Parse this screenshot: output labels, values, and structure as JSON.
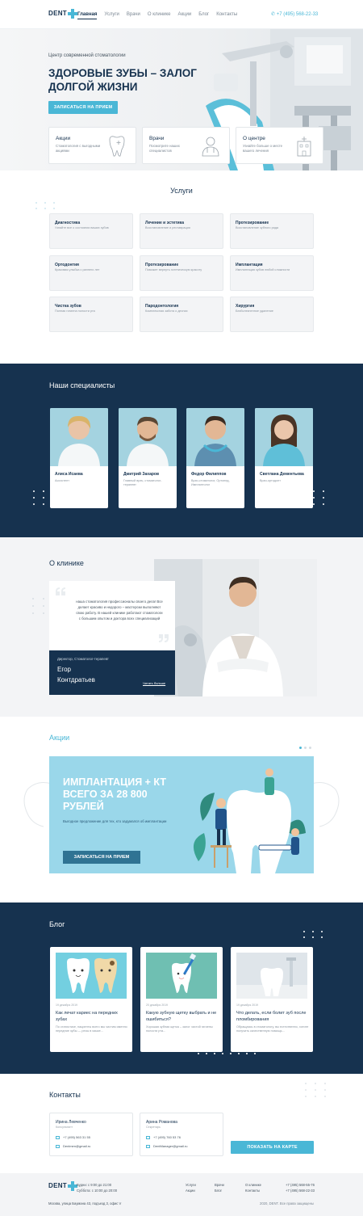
{
  "header": {
    "logo_text": "DENT",
    "nav": [
      "Главная",
      "Услуги",
      "Врачи",
      "О клинике",
      "Акции",
      "Блог",
      "Контакты"
    ],
    "phone": "+7 (495) 568-22-33"
  },
  "hero": {
    "subtitle": "Центр современной стоматологии",
    "title": "ЗДОРОВЫЕ ЗУБЫ – ЗАЛОГ ДОЛГОЙ ЖИЗНИ",
    "cta": "ЗАПИСАТЬСЯ НА ПРИЕМ",
    "features": [
      {
        "title": "Акции",
        "desc": "Стоматология с выгодными акциями",
        "icon": "tooth-icon"
      },
      {
        "title": "Врачи",
        "desc": "Посмотрите наших специалистов",
        "icon": "doctor-icon"
      },
      {
        "title": "О центре",
        "desc": "Узнайте больше о месте вашего лечения",
        "icon": "building-icon"
      }
    ]
  },
  "services": {
    "title": "Услуги",
    "items": [
      {
        "title": "Диагностика",
        "desc": "Узнайте все о состоянии ваших зубов"
      },
      {
        "title": "Лечение и эстетика",
        "desc": "Восстановление и реставрация"
      },
      {
        "title": "Протезирование",
        "desc": "Восстановление зубного ряда"
      },
      {
        "title": "Ортодонтия",
        "desc": "Красивая улыбка с раннего лет"
      },
      {
        "title": "Протезирование",
        "desc": "Поможет вернуть эстетическую красоту"
      },
      {
        "title": "Имплантация",
        "desc": "Имплантация зубов любой сложности"
      },
      {
        "title": "Чистка зубов",
        "desc": "Полная гигиена полости рта"
      },
      {
        "title": "Пародонтология",
        "desc": "Комплексная забота о деснах"
      },
      {
        "title": "Хирургия",
        "desc": "Безболезненное удаление"
      }
    ]
  },
  "specialists": {
    "title": "Наши специалисты",
    "items": [
      {
        "name": "Алиса Исаева",
        "role": "Ассистент"
      },
      {
        "name": "Дмитрий Захаров",
        "role": "Главный врач, стоматолог-терапевт"
      },
      {
        "name": "Федор Филиппов",
        "role": "Врач-стоматолог, Ортопед, Имплантолог"
      },
      {
        "name": "Светлана Дементьева",
        "role": "Врач-ортодонт"
      }
    ]
  },
  "about": {
    "title": "О клинике",
    "text": "наша стоматология профессионалы своего дела! Все делает красиво и недорого – мастерски выполняют свою работу. В нашей клинике работают стоматологи с большим опытом и доктора всех специализаций",
    "role": "Директор, Стоматолог-терапевт",
    "name_line1": "Егор",
    "name_line2": "Контдратьев",
    "more": "Читать больше"
  },
  "promo": {
    "title": "Акции",
    "headline": "ИМПЛАНТАЦИЯ + КТ ВСЕГО ЗА 28 800 РУБЛЕЙ",
    "desc": "Выгодное предложение для тех, кто задумался об имплантации",
    "cta": "ЗАПИСАТЬСЯ НА ПРИЕМ"
  },
  "blog": {
    "title": "Блог",
    "items": [
      {
        "date": "19 декабря 2019",
        "title": "Как лечат кариес на передних зубах",
        "desc": "По статистике, пациенты всего мы чистим именно передние зубы — ресы в языке..."
      },
      {
        "date": "20 декабря 2019",
        "title": "Какую зубную щетку выбрать и не ошибиться?",
        "desc": "Хорошая зубная щетка – залог чистой гигиены полости рта..."
      },
      {
        "date": "19 декабря 2019",
        "title": "Что делать, если болит зуб после пломбирования",
        "desc": "Обращаясь в стоматологу, вы естественно, хотите получить качественную помощь..."
      }
    ]
  },
  "contacts": {
    "title": "Контакты",
    "people": [
      {
        "name": "Ирина Левченко",
        "role": "Консультант",
        "phone": "+7 (495) 563 31 55",
        "email": "Denlmen@gmail.ru"
      },
      {
        "name": "Арина Романова",
        "role": "Секретарь",
        "phone": "+7 (495) 760 53 76",
        "email": "DentManager@gmail.ru"
      }
    ],
    "map_button": "ПОКАЗАТЬ НА КАРТЕ"
  },
  "footer": {
    "hours1": "Будни: с 9:00 до 21:00",
    "hours2": "Суббота: с 10:00 до 20:00",
    "address": "Москва, улица Бауманa 43, подъезд 3, офис V",
    "links": [
      "Услуги",
      "Врачи",
      "О клинике",
      "Акции",
      "Блог",
      "Контакты"
    ],
    "phones": [
      "+7 (495) 568-55-76",
      "+7 (495) 568-22-33"
    ],
    "copyright": "2020, DENT. Все права защищены"
  },
  "colors": {
    "accent": "#4ab7d6",
    "navy": "#16324f",
    "light": "#f3f4f6"
  }
}
